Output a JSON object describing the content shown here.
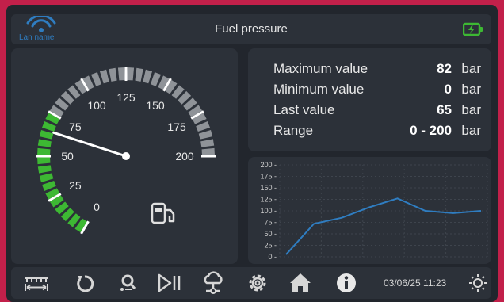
{
  "topbar": {
    "lan_label": "Lan name",
    "title": "Fuel pressure"
  },
  "gauge": {
    "min": 0,
    "max": 200,
    "value": 65,
    "tick_labels": [
      "0",
      "25",
      "50",
      "75",
      "100",
      "125",
      "150",
      "175",
      "200"
    ],
    "green_limit": 75,
    "icon": "fuel-pump-icon"
  },
  "stats": [
    {
      "label": "Maximum value",
      "value": "82",
      "unit": "bar"
    },
    {
      "label": "Minimum value",
      "value": "0",
      "unit": "bar"
    },
    {
      "label": "Last value",
      "value": "65",
      "unit": "bar"
    },
    {
      "label": "Range",
      "value": "0 - 200",
      "unit": "bar"
    }
  ],
  "chart_data": {
    "type": "line",
    "x": [
      0,
      1,
      2,
      3,
      4,
      5,
      6,
      7
    ],
    "values": [
      5,
      72,
      85,
      108,
      127,
      100,
      95,
      100
    ],
    "y_ticks": [
      "200",
      "175",
      "150",
      "125",
      "100",
      "75",
      "50",
      "25",
      "0"
    ],
    "ylim": [
      0,
      200
    ],
    "grid": true,
    "color": "#2f7dc1"
  },
  "bottombar": {
    "icons": [
      "ruler-icon",
      "refresh-icon",
      "search-zoom-icon",
      "play-pause-icon",
      "cloud-network-icon",
      "gear-icon",
      "home-icon",
      "info-icon",
      "brightness-icon"
    ],
    "datetime": "03/06/25 11:23"
  },
  "colors": {
    "accent": "#2f7dc1",
    "green": "#3db833",
    "frame": "#c2204a"
  }
}
